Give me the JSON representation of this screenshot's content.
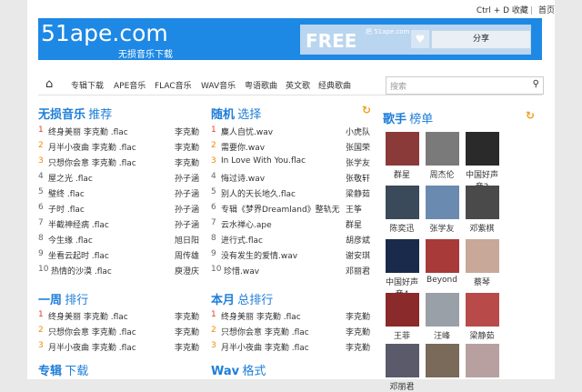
{
  "topbar": {
    "shortcut": "Ctrl + D 收藏",
    "home": "首页"
  },
  "banner": {
    "logo_main": "51ape.com",
    "logo_sub": "无损音乐下载",
    "free": "FREE",
    "free_sub": "把 51ape.com",
    "share": "分享"
  },
  "nav": {
    "items": [
      "专辑下载",
      "APE音乐",
      "FLAC音乐",
      "WAV音乐",
      "粤语歌曲",
      "英文歌",
      "经典歌曲"
    ],
    "search_placeholder": "搜索"
  },
  "lossless": {
    "title_a": "无损音乐",
    "title_b": "推荐",
    "rows": [
      {
        "num": "1",
        "song": "终身美丽 李克勤 .flac",
        "artist": "李克勤"
      },
      {
        "num": "2",
        "song": "月半小夜曲 李克勤 .flac",
        "artist": "李克勤"
      },
      {
        "num": "3",
        "song": "只想你会意 李克勤 .flac",
        "artist": "李克勤"
      },
      {
        "num": "4",
        "song": "屋之光 .flac",
        "artist": "孙子涵"
      },
      {
        "num": "5",
        "song": "璧终 .flac",
        "artist": "孙子涵"
      },
      {
        "num": "6",
        "song": "子时 .flac",
        "artist": "孙子涵"
      },
      {
        "num": "7",
        "song": "半截神经病 .flac",
        "artist": "孙子涵"
      },
      {
        "num": "8",
        "song": "今生缘 .flac",
        "artist": "旭日阳"
      },
      {
        "num": "9",
        "song": "坐看云起时 .flac",
        "artist": "周传雄"
      },
      {
        "num": "10",
        "song": "热情的沙漠 .flac",
        "artist": "庾澄庆"
      }
    ]
  },
  "random": {
    "title_a": "随机",
    "title_b": "选择",
    "rows": [
      {
        "num": "1",
        "song": "麋人自忧.wav",
        "artist": "小虎队"
      },
      {
        "num": "2",
        "song": "需要你.wav",
        "artist": "张国荣"
      },
      {
        "num": "3",
        "song": "In Love With You.flac",
        "artist": "张学友"
      },
      {
        "num": "4",
        "song": "悔过诗.wav",
        "artist": "张敬轩"
      },
      {
        "num": "5",
        "song": "别人的天长地久.flac",
        "artist": "梁静茹"
      },
      {
        "num": "6",
        "song": "专辑《梦界Dreamland》整轨无",
        "artist": "王筝"
      },
      {
        "num": "7",
        "song": "云水禅心.ape",
        "artist": "群星"
      },
      {
        "num": "8",
        "song": "进行式.flac",
        "artist": "胡彦斌"
      },
      {
        "num": "9",
        "song": "没有发生的爱情.wav",
        "artist": "谢安琪"
      },
      {
        "num": "10",
        "song": "珍惜.wav",
        "artist": "邓丽君"
      }
    ]
  },
  "weekly": {
    "title_a": "一周",
    "title_b": "排行",
    "rows": [
      {
        "num": "1",
        "song": "终身美丽 李克勤 .flac",
        "artist": "李克勤"
      },
      {
        "num": "2",
        "song": "只想你会意 李克勤 .flac",
        "artist": "李克勤"
      },
      {
        "num": "3",
        "song": "月半小夜曲 李克勤 .flac",
        "artist": "李克勤"
      }
    ]
  },
  "monthly": {
    "title_a": "本月",
    "title_b": "总排行",
    "rows": [
      {
        "num": "1",
        "song": "终身美丽 李克勤 .flac",
        "artist": "李克勤"
      },
      {
        "num": "2",
        "song": "只想你会意 李克勤 .flac",
        "artist": "李克勤"
      },
      {
        "num": "3",
        "song": "月半小夜曲 李克勤 .flac",
        "artist": "李克勤"
      }
    ]
  },
  "album": {
    "title_a": "专辑",
    "title_b": "下载"
  },
  "wav": {
    "title_a": "Wav",
    "title_b": "格式"
  },
  "singers": {
    "title_a": "歌手",
    "title_b": "榜单",
    "items": [
      {
        "name": "群星",
        "color": "#8b3a3a"
      },
      {
        "name": "周杰伦",
        "color": "#7a7a7a"
      },
      {
        "name": "中国好声音3",
        "color": "#2a2a2a"
      },
      {
        "name": "陈奕迅",
        "color": "#3a4a5a"
      },
      {
        "name": "张学友",
        "color": "#6a8ab0"
      },
      {
        "name": "邓紫棋",
        "color": "#4a4a4a"
      },
      {
        "name": "中国好声音4",
        "color": "#1a2a4a"
      },
      {
        "name": "Beyond",
        "color": "#a83a3a"
      },
      {
        "name": "蔡琴",
        "color": "#c8a898"
      },
      {
        "name": "王菲",
        "color": "#8a2a2a"
      },
      {
        "name": "汪峰",
        "color": "#9aa0a8"
      },
      {
        "name": "梁静茹",
        "color": "#b84a4a"
      },
      {
        "name": "邓丽君",
        "color": "#d8a888"
      },
      {
        "name": "",
        "color": "#6a5a4a"
      },
      {
        "name": "",
        "color": "#b8a0a0"
      },
      {
        "name": "",
        "color": "#5a5a6a"
      },
      {
        "name": "",
        "color": "#7a6a5a"
      }
    ]
  },
  "colors": {
    "accent": "#1e7ed8",
    "banner": "#1e88e5",
    "rank1": "#e83a24",
    "rank2_3": "#f08a00"
  }
}
